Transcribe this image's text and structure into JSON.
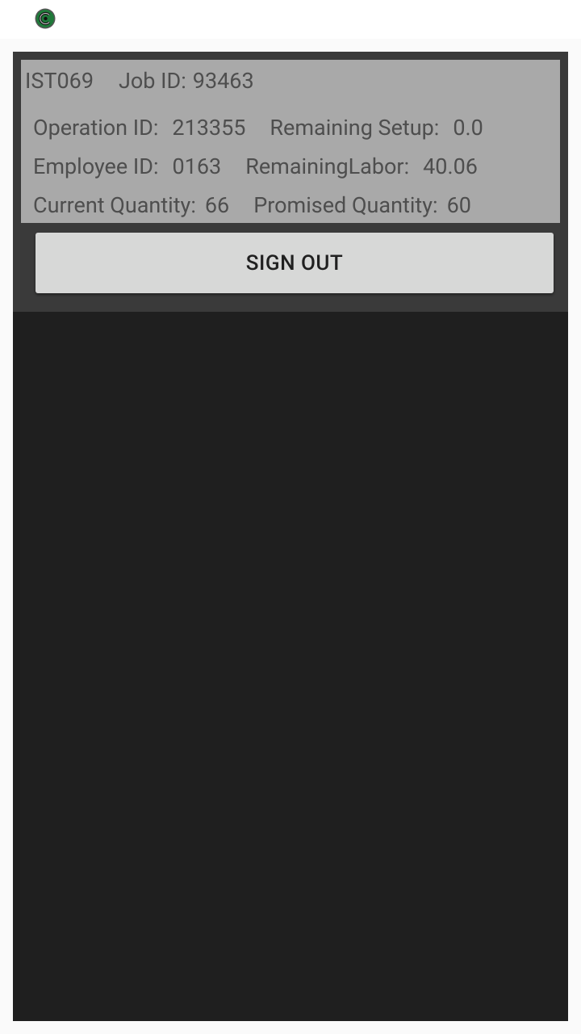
{
  "app": {
    "logo_icon": "app-logo-icon"
  },
  "header": {
    "machine_id": "IST069",
    "job_label": "Job ID:",
    "job_id": "93463",
    "operation_label": "Operation ID:",
    "operation_id": "213355",
    "remaining_setup_label": "Remaining Setup:",
    "remaining_setup": "0.0",
    "employee_label": "Employee ID:",
    "employee_id": "0163",
    "remaining_labor_label": "RemainingLabor:",
    "remaining_labor": "40.06",
    "current_qty_label": "Current Quantity:",
    "current_qty": "66",
    "promised_qty_label": "Promised Quantity:",
    "promised_qty": "60"
  },
  "actions": {
    "sign_out_label": "SIGN OUT"
  },
  "colors": {
    "info_box_bg": "#a9a9a9",
    "panel_bg": "#3a3a3a",
    "content_bg": "#1f1f1f",
    "button_bg": "#d7d8d7",
    "logo_green": "#1f7a3a"
  }
}
